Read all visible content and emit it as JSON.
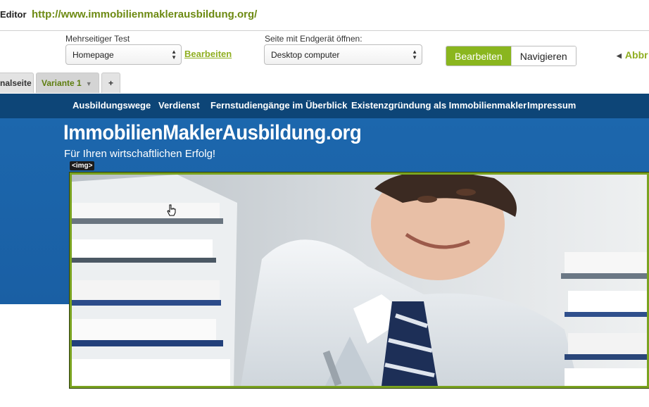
{
  "app": {
    "name": "Editor",
    "url": "http://www.immobilienmaklerausbildung.org/"
  },
  "controls": {
    "test_label": "Mehrseitiger Test",
    "test_select": "Homepage",
    "edit_link": "Bearbeiten",
    "device_label": "Seite mit Endgerät öffnen:",
    "device_select": "Desktop computer",
    "mode_edit": "Bearbeiten",
    "mode_navigate": "Navigieren",
    "cancel_link": "Abbr"
  },
  "tabs": [
    {
      "label": "nalseite"
    },
    {
      "label": "Variante 1"
    },
    {
      "label": "+"
    }
  ],
  "site": {
    "nav": [
      "Ausbildungswege",
      "Verdienst",
      "Fernstudiengänge im Überblick",
      "Existenzgründung als Immobilienmakler",
      "Impressum"
    ],
    "title": "ImmobilienMaklerAusbildung.org",
    "tagline": "Für Ihren wirtschaftlichen Erfolg!",
    "img_tag": "<img>"
  },
  "colors": {
    "accent": "#8ab61e",
    "nav_bg": "#0d4577",
    "header_bg": "#1c67ad",
    "link": "#8fae20"
  },
  "icons": {
    "select_arrows": "updown-icon",
    "caret": "caret-down-icon",
    "cursor": "hand-cursor-icon"
  }
}
